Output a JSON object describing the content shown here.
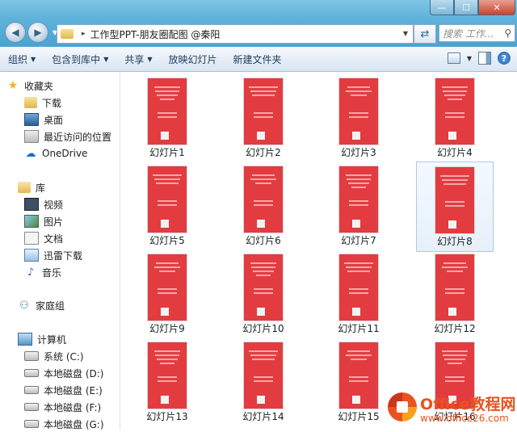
{
  "window": {
    "min_glyph": "—",
    "max_glyph": "☐",
    "close_glyph": "✕"
  },
  "address": {
    "path": "工作型PPT-朋友圈配图 @秦阳",
    "separator": "▸",
    "search_placeholder": "搜索 工作..."
  },
  "toolbar": {
    "organize": "组织",
    "include_library": "包含到库中",
    "share": "共享",
    "slideshow": "放映幻灯片",
    "new_folder": "新建文件夹"
  },
  "sidebar": {
    "favorites": "收藏夹",
    "downloads": "下载",
    "desktop": "桌面",
    "recent": "最近访问的位置",
    "onedrive": "OneDrive",
    "libraries": "库",
    "videos": "视频",
    "pictures": "图片",
    "documents": "文档",
    "thunder": "迅雷下载",
    "music": "音乐",
    "homegroup": "家庭组",
    "computer": "计算机",
    "drive_c": "系统 (C:)",
    "drive_d": "本地磁盘 (D:)",
    "drive_e": "本地磁盘 (E:)",
    "drive_f": "本地磁盘 (F:)",
    "drive_g": "本地磁盘 (G:)"
  },
  "files": [
    {
      "label": "幻灯片1"
    },
    {
      "label": "幻灯片2"
    },
    {
      "label": "幻灯片3"
    },
    {
      "label": "幻灯片4"
    },
    {
      "label": "幻灯片5"
    },
    {
      "label": "幻灯片6"
    },
    {
      "label": "幻灯片7"
    },
    {
      "label": "幻灯片8",
      "selected": true
    },
    {
      "label": "幻灯片9"
    },
    {
      "label": "幻灯片10"
    },
    {
      "label": "幻灯片11"
    },
    {
      "label": "幻灯片12"
    },
    {
      "label": "幻灯片13"
    },
    {
      "label": "幻灯片14"
    },
    {
      "label": "幻灯片15"
    },
    {
      "label": "幻灯片16"
    }
  ],
  "watermark": {
    "title": "Office教程网",
    "url": "www.office26.com"
  },
  "colors": {
    "thumb_red": "#e23c40",
    "accent_blue": "#4aa3d0",
    "watermark_orange": "#e8531e"
  }
}
